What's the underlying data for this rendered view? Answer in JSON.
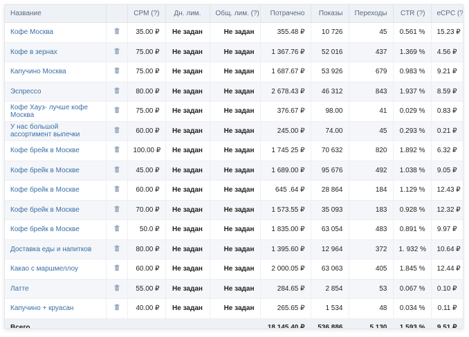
{
  "headers": {
    "name": "Название",
    "cpm": "CPM (?)",
    "day_limit": "Дн. лим.",
    "total_limit": "Общ. лим. (?)",
    "spent": "Потрачено",
    "impressions": "Показы",
    "clicks": "Переходы",
    "ctr": "CTR (?)",
    "ecpc": "eCPC (?)"
  },
  "icons": {
    "delete": "trash-icon"
  },
  "colors": {
    "link": "#3a6ea5",
    "header_bg": "#eef1f5",
    "row_alt": "#f4f6f9"
  },
  "rows": [
    {
      "name": "Кофе Москва",
      "cpm": "35.00 ₽",
      "day_limit": "Не задан",
      "total_limit": "Не задан",
      "spent": "355.48 ₽",
      "impressions": "10 726",
      "clicks": "45",
      "ctr": "0.561 %",
      "ecpc": "15.23 ₽"
    },
    {
      "name": "Кофе в зернах",
      "cpm": "75.00 ₽",
      "day_limit": "Не задан",
      "total_limit": "Не задан",
      "spent": "1 367.76 ₽",
      "impressions": "52 016",
      "clicks": "437",
      "ctr": "1.369 %",
      "ecpc": "4.56 ₽"
    },
    {
      "name": "Капучино Москва",
      "cpm": "75.00 ₽",
      "day_limit": "Не задан",
      "total_limit": "Не задан",
      "spent": "1 687.67 ₽",
      "impressions": "53 926",
      "clicks": "679",
      "ctr": "0.983 %",
      "ecpc": "9.21 ₽"
    },
    {
      "name": "Эспрессо",
      "cpm": "80.00 ₽",
      "day_limit": "Не задан",
      "total_limit": "Не задан",
      "spent": "2 678.43 ₽",
      "impressions": "46 312",
      "clicks": "843",
      "ctr": "1.937 %",
      "ecpc": "8.59 ₽"
    },
    {
      "name": "Кофе Хауз- лучше кофе Москва",
      "cpm": "75.00 ₽",
      "day_limit": "Не задан",
      "total_limit": "Не задан",
      "spent": "376.67 ₽",
      "impressions": "98.00",
      "clicks": "41",
      "ctr": "0.029 %",
      "ecpc": "0.83 ₽"
    },
    {
      "name": "У нас большой ассортимент выпечки",
      "cpm": "60.00 ₽",
      "day_limit": "Не задан",
      "total_limit": "Не задан",
      "spent": "245.00 ₽",
      "impressions": "74.00",
      "clicks": "45",
      "ctr": "0.293 %",
      "ecpc": "0.21 ₽"
    },
    {
      "name": "Кофе брейк в Москве",
      "cpm": "100.00 ₽",
      "day_limit": "Не задан",
      "total_limit": "Не задан",
      "spent": "1 745 25 ₽",
      "impressions": "70 632",
      "clicks": "820",
      "ctr": "1.892 %",
      "ecpc": "6.32 ₽"
    },
    {
      "name": "Кофе брейк в Москве",
      "cpm": "45.00 ₽",
      "day_limit": "Не задан",
      "total_limit": "Не задан",
      "spent": "1 689.00 ₽",
      "impressions": "95 676",
      "clicks": "492",
      "ctr": "1.038 %",
      "ecpc": "9.05 ₽"
    },
    {
      "name": "Кофе брейк в Москве",
      "cpm": "60.00 ₽",
      "day_limit": "Не задан",
      "total_limit": "Не задан",
      "spent": "645 .64 ₽",
      "impressions": "28 864",
      "clicks": "184",
      "ctr": "1.129 %",
      "ecpc": "12.43 ₽"
    },
    {
      "name": "Кофе брейк в Москве",
      "cpm": "70.00 ₽",
      "day_limit": "Не задан",
      "total_limit": "Не задан",
      "spent": "1 573.55 ₽",
      "impressions": "35 093",
      "clicks": "183",
      "ctr": "0.928 %",
      "ecpc": "12.32 ₽"
    },
    {
      "name": "Кофе брейк в Москве",
      "cpm": "50.0 ₽",
      "day_limit": "Не задан",
      "total_limit": "Не задан",
      "spent": "1 835.00 ₽",
      "impressions": "63 054",
      "clicks": "483",
      "ctr": "0.891 %",
      "ecpc": "9.97 ₽"
    },
    {
      "name": "Доставка еды и напитков",
      "cpm": "80.00 ₽",
      "day_limit": "Не задан",
      "total_limit": "Не задан",
      "spent": "1 395.60 ₽",
      "impressions": "12 964",
      "clicks": "372",
      "ctr": "1. 932 %",
      "ecpc": "10.64 ₽"
    },
    {
      "name": "Какао с маршмеллоу",
      "cpm": "60.00 ₽",
      "day_limit": "Не задан",
      "total_limit": "Не задан",
      "spent": "2 000.05 ₽",
      "impressions": "63 063",
      "clicks": "405",
      "ctr": "1.845 %",
      "ecpc": "12.44 ₽"
    },
    {
      "name": "Латте",
      "cpm": "55.00 ₽",
      "day_limit": "Не задан",
      "total_limit": "Не задан",
      "spent": "284.65 ₽",
      "impressions": "2 854",
      "clicks": "53",
      "ctr": "0.067 %",
      "ecpc": "0.10 ₽"
    },
    {
      "name": "Капучино + круасан",
      "cpm": "40.00 ₽",
      "day_limit": "Не задан",
      "total_limit": "Не задан",
      "spent": "265.65 ₽",
      "impressions": "1 534",
      "clicks": "48",
      "ctr": "0.034 %",
      "ecpc": "0.11 ₽"
    }
  ],
  "total": {
    "label": "Всего",
    "spent": "18 145,40 ₽",
    "impressions": "536 886",
    "clicks": "5 130",
    "ctr": "1.593 %",
    "ecpc": "9.51 ₽"
  }
}
